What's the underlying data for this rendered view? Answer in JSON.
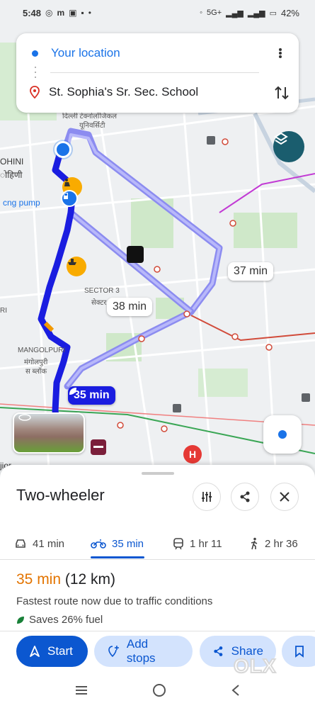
{
  "status_bar": {
    "time": "5:48",
    "network": "5G+",
    "battery": "42%"
  },
  "search": {
    "origin": "Your location",
    "destination": "St. Sophia's Sr. Sec. School"
  },
  "map": {
    "labels": {
      "university": "दिल्ली टेक्नोलॉजिकल",
      "university2": "यूनिवर्सिटी",
      "rohini": "OHINI",
      "rohini_hi": "ोहिणी",
      "cng_pump": "cng pump",
      "sector3": "SECTOR 3",
      "sector3_hi": "सेक्टर",
      "mangolpuri": "MANGOLPURI",
      "mangolpuri_hi": "मंगोलपुरी",
      "mangolpuri_hi2": "स ब्लॉक",
      "ri": "RI",
      "jior": "jior"
    },
    "route_bubbles": {
      "alt1": "37 min",
      "alt2": "38 min",
      "selected": "35 min"
    }
  },
  "sheet": {
    "title": "Two-wheeler",
    "modes": [
      {
        "icon": "car-icon",
        "label": "41 min"
      },
      {
        "icon": "motorbike-icon",
        "label": "35 min"
      },
      {
        "icon": "train-icon",
        "label": "1 hr 11"
      },
      {
        "icon": "walk-icon",
        "label": "2 hr 36"
      }
    ],
    "summary_time": "35 min",
    "summary_distance": "(12 km)",
    "description": "Fastest route now due to traffic conditions",
    "fuel": "Saves 26% fuel",
    "actions": {
      "start": "Start",
      "add_stops": "Add stops",
      "share": "Share"
    }
  },
  "watermark": "OLX",
  "colors": {
    "accent_blue": "#0b57d0",
    "route_selected": "#1a1de0",
    "route_alt": "#8c8cf0",
    "time_orange": "#e37400"
  }
}
